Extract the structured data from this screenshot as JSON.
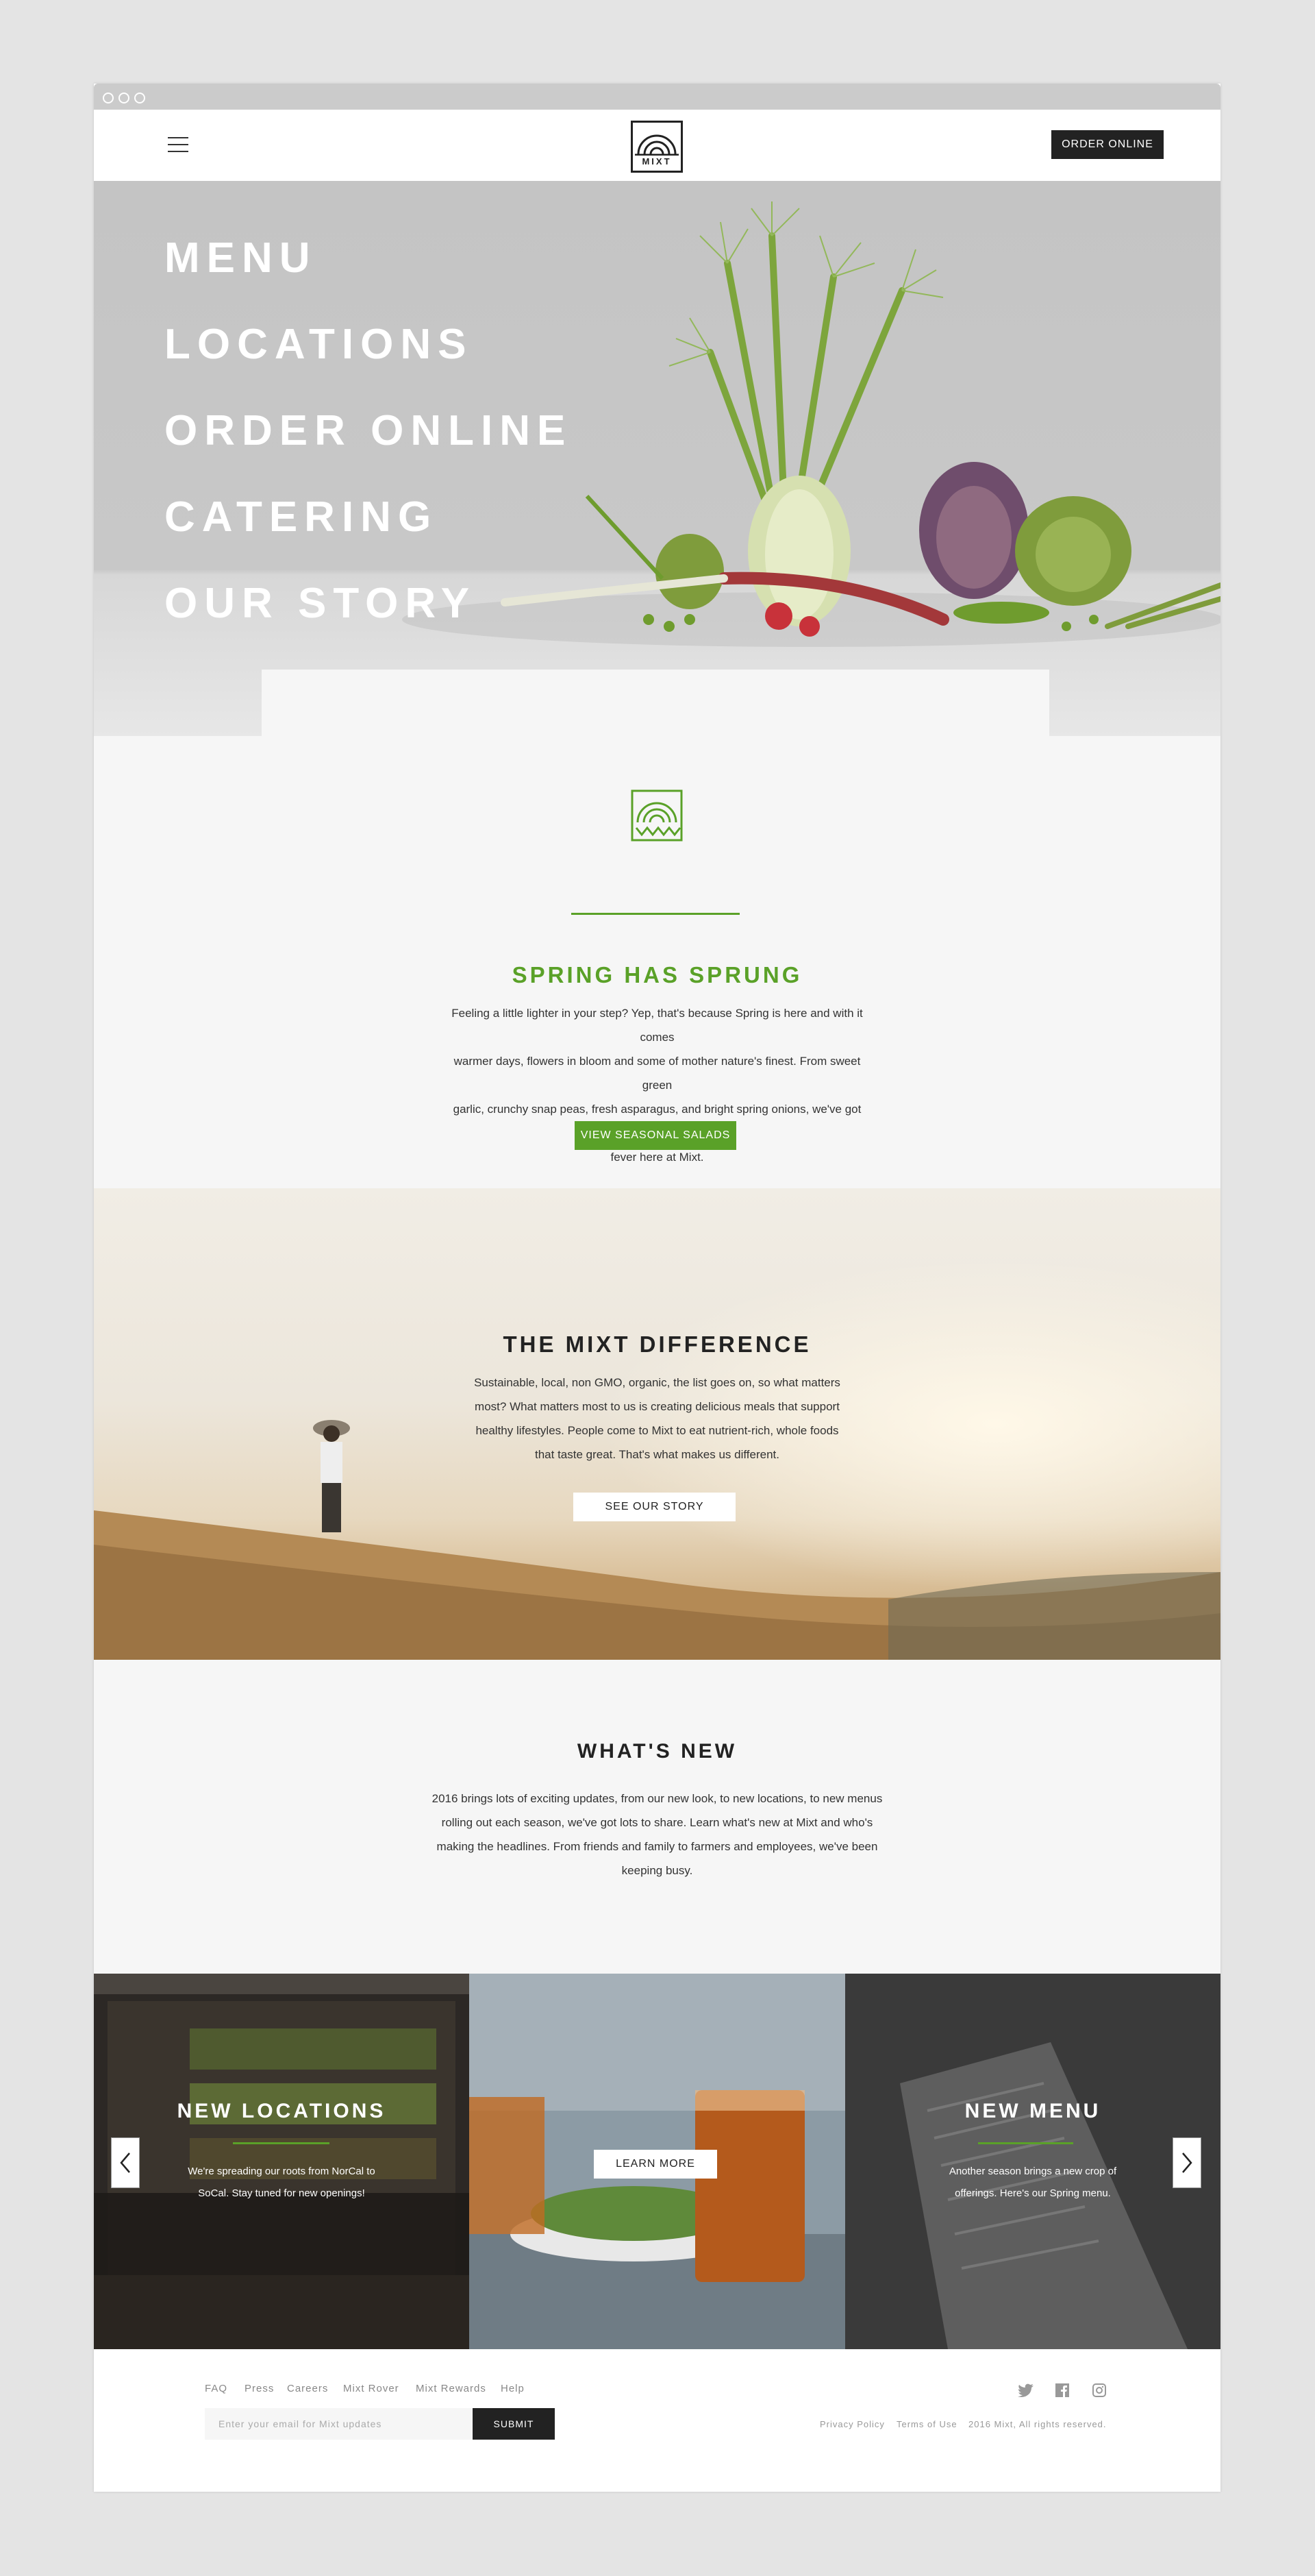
{
  "colors": {
    "accent": "#5aa128",
    "dark": "#222222",
    "panel": "#f6f6f6"
  },
  "header": {
    "logo_text": "MIXT",
    "order_label": "ORDER ONLINE"
  },
  "hero": {
    "menu_items": [
      "MENU",
      "LOCATIONS",
      "ORDER ONLINE",
      "CATERING",
      "OUR STORY"
    ]
  },
  "spring": {
    "title": "SPRING HAS SPRUNG",
    "lines": [
      "Feeling a little lighter in your step? Yep, that's because Spring is here and with it comes",
      "warmer days, flowers in bloom and some of mother nature's finest. From sweet green",
      "garlic, crunchy snap peas, fresh asparagus, and bright spring onions, we've got spring",
      "fever here at Mixt."
    ],
    "button_label": "VIEW SEASONAL SALADS"
  },
  "difference": {
    "title": "THE MIXT DIFFERENCE",
    "lines": [
      "Sustainable, local, non GMO, organic, the list goes on, so what matters",
      "most? What matters most to us is creating delicious meals that support",
      "healthy lifestyles. People come to Mixt to eat nutrient-rich, whole foods",
      "that taste great. That's what makes us different."
    ],
    "button_label": "SEE OUR STORY"
  },
  "whats_new": {
    "title": "WHAT'S NEW",
    "lines": [
      "2016 brings lots of exciting updates, from our new look, to new locations, to new menus",
      "rolling out each season, we've got lots to share. Learn what's new at Mixt and who's",
      "making the headlines. From friends and family to farmers and employees, we've been",
      "keeping busy."
    ]
  },
  "tiles": {
    "locations": {
      "title": "NEW LOCATIONS",
      "lines": [
        "We're spreading our roots from NorCal to",
        "SoCal. Stay tuned for new openings!"
      ]
    },
    "center": {
      "button_label": "LEARN MORE"
    },
    "menu": {
      "title": "NEW MENU",
      "lines": [
        "Another season brings a new crop of",
        "offerings. Here's our Spring menu."
      ]
    }
  },
  "footer": {
    "links": [
      "FAQ",
      "Press",
      "Careers",
      "Mixt Rover",
      "Mixt Rewards",
      "Help"
    ],
    "email_placeholder": "Enter your email for Mixt updates",
    "submit_label": "SUBMIT",
    "legal": [
      "Privacy Policy",
      "Terms of Use",
      "2016 Mixt, All rights reserved."
    ]
  }
}
